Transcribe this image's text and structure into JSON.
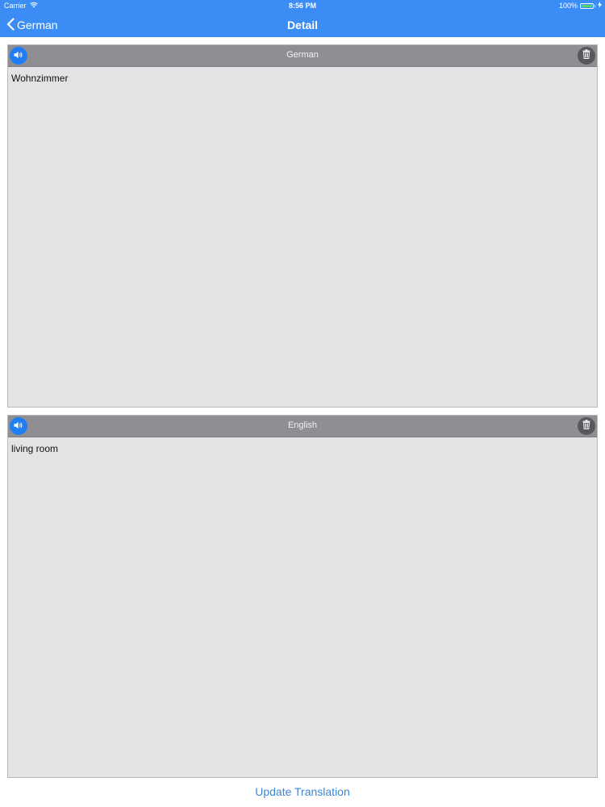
{
  "status_bar": {
    "carrier": "Carrier",
    "time": "8:56 PM",
    "battery_percent": "100%",
    "battery_level": 1.0
  },
  "nav": {
    "back_label": "German",
    "title": "Detail"
  },
  "panels": [
    {
      "language": "German",
      "text": "Wohnzimmer"
    },
    {
      "language": "English",
      "text": "living room"
    }
  ],
  "actions": {
    "update_label": "Update Translation"
  },
  "icons": {
    "back": "chevron-left-icon",
    "speaker": "speaker-icon",
    "trash": "trash-icon",
    "wifi": "wifi-icon",
    "battery": "battery-icon",
    "charging": "bolt-icon"
  },
  "colors": {
    "nav_background": "#3c8cf6",
    "speaker_button": "#1f7ef5",
    "trash_button": "#58575b",
    "panel_header": "#8f8e92",
    "panel_body": "#e3e2e4",
    "link": "#3a86d8"
  }
}
